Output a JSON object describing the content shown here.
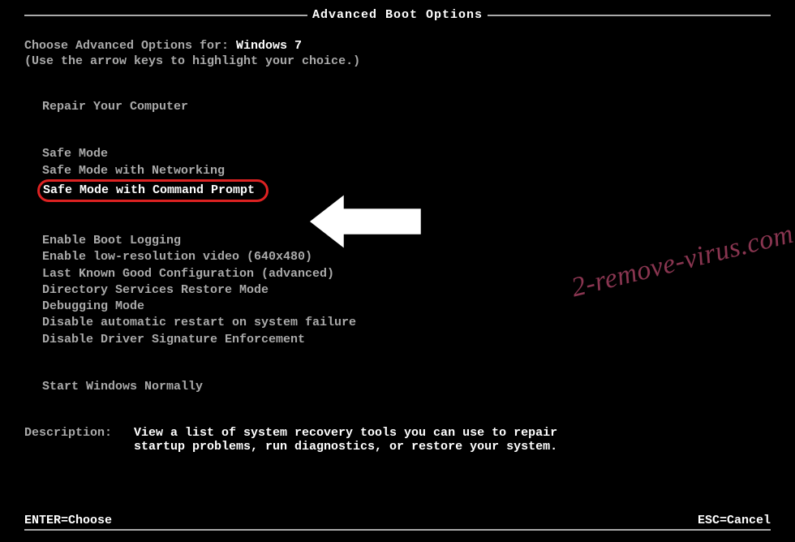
{
  "title": "Advanced Boot Options",
  "prompt": {
    "prefix": "Choose Advanced Options for: ",
    "os": "Windows 7",
    "hint": "(Use the arrow keys to highlight your choice.)"
  },
  "menu": {
    "group1": [
      "Repair Your Computer"
    ],
    "group2": [
      "Safe Mode",
      "Safe Mode with Networking",
      "Safe Mode with Command Prompt"
    ],
    "group3": [
      "Enable Boot Logging",
      "Enable low-resolution video (640x480)",
      "Last Known Good Configuration (advanced)",
      "Directory Services Restore Mode",
      "Debugging Mode",
      "Disable automatic restart on system failure",
      "Disable Driver Signature Enforcement"
    ],
    "group4": [
      "Start Windows Normally"
    ],
    "highlighted_index": 2
  },
  "description": {
    "label": "Description:",
    "text": "View a list of system recovery tools you can use to repair startup problems, run diagnostics, or restore your system."
  },
  "footer": {
    "left": "ENTER=Choose",
    "right": "ESC=Cancel"
  },
  "watermark": "2-remove-virus.com",
  "highlight_color": "#d22"
}
